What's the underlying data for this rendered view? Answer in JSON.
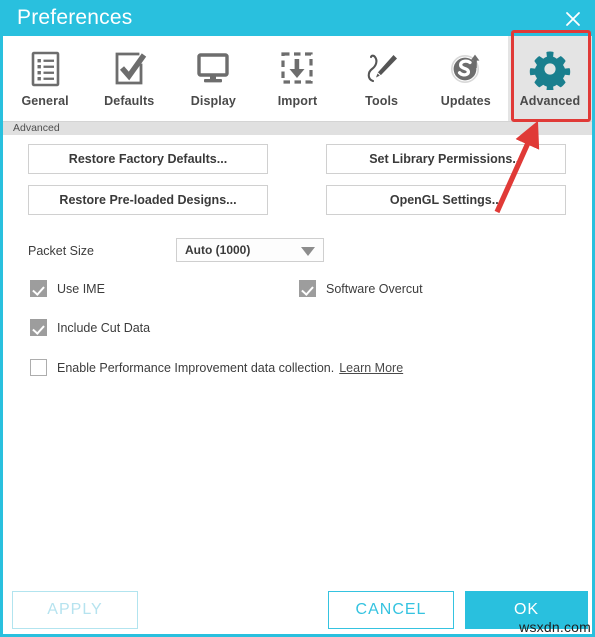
{
  "window": {
    "title": "Preferences",
    "close_icon": "close-icon",
    "accent_color": "#29c0de"
  },
  "toolbar": {
    "tabs": [
      {
        "label": "General",
        "icon": "list-document-icon",
        "active": false
      },
      {
        "label": "Defaults",
        "icon": "checkbox-check-icon",
        "active": false
      },
      {
        "label": "Display",
        "icon": "monitor-icon",
        "active": false
      },
      {
        "label": "Import",
        "icon": "import-download-icon",
        "active": false
      },
      {
        "label": "Tools",
        "icon": "pencil-curve-icon",
        "active": false
      },
      {
        "label": "Updates",
        "icon": "silhouette-update-icon",
        "active": false
      },
      {
        "label": "Advanced",
        "icon": "gear-icon",
        "active": true
      }
    ],
    "active_icon_color": "#1a7f8e",
    "inactive_icon_color": "#6d6d6d"
  },
  "breadcrumb": {
    "text": "Advanced"
  },
  "main": {
    "buttons": [
      {
        "id": "restore-factory-defaults",
        "label": "Restore Factory Defaults..."
      },
      {
        "id": "restore-preloaded-designs",
        "label": "Restore Pre-loaded Designs..."
      },
      {
        "id": "set-library-permissions",
        "label": "Set Library Permissions..."
      },
      {
        "id": "opengl-settings",
        "label": "OpenGL Settings..."
      }
    ],
    "packet_size": {
      "label": "Packet Size",
      "value": "Auto (1000)",
      "options": [
        "Auto (1000)"
      ]
    },
    "checkboxes": [
      {
        "id": "use-ime",
        "label": "Use IME",
        "checked": true
      },
      {
        "id": "software-overcut",
        "label": "Software Overcut",
        "checked": true
      },
      {
        "id": "include-cut-data",
        "label": "Include Cut Data",
        "checked": true
      },
      {
        "id": "enable-performance-improvement",
        "label": "Enable Performance Improvement data collection.",
        "checked": false
      }
    ],
    "learn_more_link": "Learn More"
  },
  "footer": {
    "apply_label": "APPLY",
    "apply_disabled": true,
    "cancel_label": "CANCEL",
    "ok_label": "OK"
  },
  "annotations": {
    "highlight_color": "#e03a37",
    "highlight_target": "Advanced",
    "arrow": "points from content area up to Advanced tab"
  },
  "watermark": {
    "text": "wsxdn.com"
  }
}
